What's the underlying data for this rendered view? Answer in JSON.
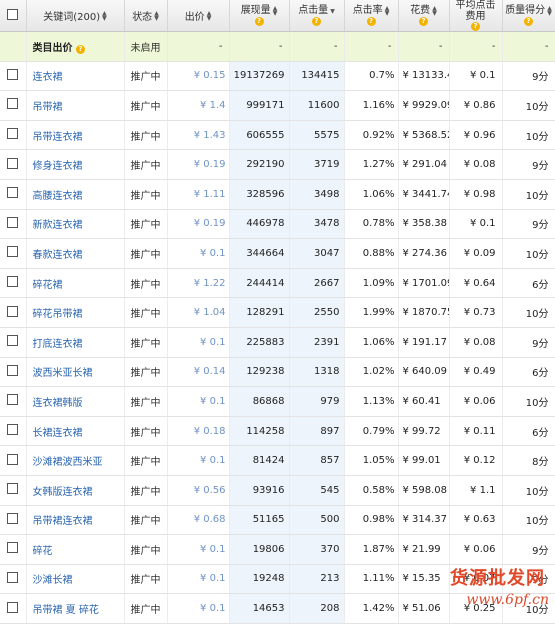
{
  "header": {
    "keyword": "关键词(200)",
    "status": "状态",
    "bid": "出价",
    "impressions": "展现量",
    "clicks": "点击量",
    "ctr": "点击率",
    "cost": "花费",
    "avg_cpc": "平均点击费用",
    "quality": "质量得分"
  },
  "category_row": {
    "name": "类目出价",
    "status": "未启用",
    "dash": "-"
  },
  "rows": [
    {
      "kw": "连衣裙",
      "status": "推广中",
      "bid": "¥ 0.15",
      "imp": "19137269",
      "clk": "134415",
      "ctr": "0.7%",
      "cost": "¥ 13133.44",
      "cpc": "¥ 0.1",
      "q": "9分"
    },
    {
      "kw": "吊带裙",
      "status": "推广中",
      "bid": "¥ 1.4",
      "imp": "999171",
      "clk": "11600",
      "ctr": "1.16%",
      "cost": "¥ 9929.09",
      "cpc": "¥ 0.86",
      "q": "10分"
    },
    {
      "kw": "吊带连衣裙",
      "status": "推广中",
      "bid": "¥ 1.43",
      "imp": "606555",
      "clk": "5575",
      "ctr": "0.92%",
      "cost": "¥ 5368.52",
      "cpc": "¥ 0.96",
      "q": "10分"
    },
    {
      "kw": "修身连衣裙",
      "status": "推广中",
      "bid": "¥ 0.19",
      "imp": "292190",
      "clk": "3719",
      "ctr": "1.27%",
      "cost": "¥ 291.04",
      "cpc": "¥ 0.08",
      "q": "9分"
    },
    {
      "kw": "高腰连衣裙",
      "status": "推广中",
      "bid": "¥ 1.11",
      "imp": "328596",
      "clk": "3498",
      "ctr": "1.06%",
      "cost": "¥ 3441.74",
      "cpc": "¥ 0.98",
      "q": "10分"
    },
    {
      "kw": "新款连衣裙",
      "status": "推广中",
      "bid": "¥ 0.19",
      "imp": "446978",
      "clk": "3478",
      "ctr": "0.78%",
      "cost": "¥ 358.38",
      "cpc": "¥ 0.1",
      "q": "9分"
    },
    {
      "kw": "春款连衣裙",
      "status": "推广中",
      "bid": "¥ 0.1",
      "imp": "344664",
      "clk": "3047",
      "ctr": "0.88%",
      "cost": "¥ 274.36",
      "cpc": "¥ 0.09",
      "q": "10分"
    },
    {
      "kw": "碎花裙",
      "status": "推广中",
      "bid": "¥ 1.22",
      "imp": "244414",
      "clk": "2667",
      "ctr": "1.09%",
      "cost": "¥ 1701.09",
      "cpc": "¥ 0.64",
      "q": "6分"
    },
    {
      "kw": "碎花吊带裙",
      "status": "推广中",
      "bid": "¥ 1.04",
      "imp": "128291",
      "clk": "2550",
      "ctr": "1.99%",
      "cost": "¥ 1870.75",
      "cpc": "¥ 0.73",
      "q": "10分"
    },
    {
      "kw": "打底连衣裙",
      "status": "推广中",
      "bid": "¥ 0.1",
      "imp": "225883",
      "clk": "2391",
      "ctr": "1.06%",
      "cost": "¥ 191.17",
      "cpc": "¥ 0.08",
      "q": "9分"
    },
    {
      "kw": "波西米亚长裙",
      "status": "推广中",
      "bid": "¥ 0.14",
      "imp": "129238",
      "clk": "1318",
      "ctr": "1.02%",
      "cost": "¥ 640.09",
      "cpc": "¥ 0.49",
      "q": "6分"
    },
    {
      "kw": "连衣裙韩版",
      "status": "推广中",
      "bid": "¥ 0.1",
      "imp": "86868",
      "clk": "979",
      "ctr": "1.13%",
      "cost": "¥ 60.41",
      "cpc": "¥ 0.06",
      "q": "10分"
    },
    {
      "kw": "长裙连衣裙",
      "status": "推广中",
      "bid": "¥ 0.18",
      "imp": "114258",
      "clk": "897",
      "ctr": "0.79%",
      "cost": "¥ 99.72",
      "cpc": "¥ 0.11",
      "q": "6分"
    },
    {
      "kw": "沙滩裙波西米亚",
      "status": "推广中",
      "bid": "¥ 0.1",
      "imp": "81424",
      "clk": "857",
      "ctr": "1.05%",
      "cost": "¥ 99.01",
      "cpc": "¥ 0.12",
      "q": "8分"
    },
    {
      "kw": "女韩版连衣裙",
      "status": "推广中",
      "bid": "¥ 0.56",
      "imp": "93916",
      "clk": "545",
      "ctr": "0.58%",
      "cost": "¥ 598.08",
      "cpc": "¥ 1.1",
      "q": "10分"
    },
    {
      "kw": "吊带裙连衣裙",
      "status": "推广中",
      "bid": "¥ 0.68",
      "imp": "51165",
      "clk": "500",
      "ctr": "0.98%",
      "cost": "¥ 314.37",
      "cpc": "¥ 0.63",
      "q": "10分"
    },
    {
      "kw": "碎花",
      "status": "推广中",
      "bid": "¥ 0.1",
      "imp": "19806",
      "clk": "370",
      "ctr": "1.87%",
      "cost": "¥ 21.99",
      "cpc": "¥ 0.06",
      "q": "9分"
    },
    {
      "kw": "沙滩长裙",
      "status": "推广中",
      "bid": "¥ 0.1",
      "imp": "19248",
      "clk": "213",
      "ctr": "1.11%",
      "cost": "¥ 15.35",
      "cpc": "¥ 0.07",
      "q": "9分"
    },
    {
      "kw": "吊带裙 夏 碎花",
      "status": "推广中",
      "bid": "¥ 0.1",
      "imp": "14653",
      "clk": "208",
      "ctr": "1.42%",
      "cost": "¥ 51.06",
      "cpc": "¥ 0.25",
      "q": "10分"
    }
  ],
  "watermark": {
    "line1": "货源批发网",
    "line2": "www.6pf.cn"
  }
}
